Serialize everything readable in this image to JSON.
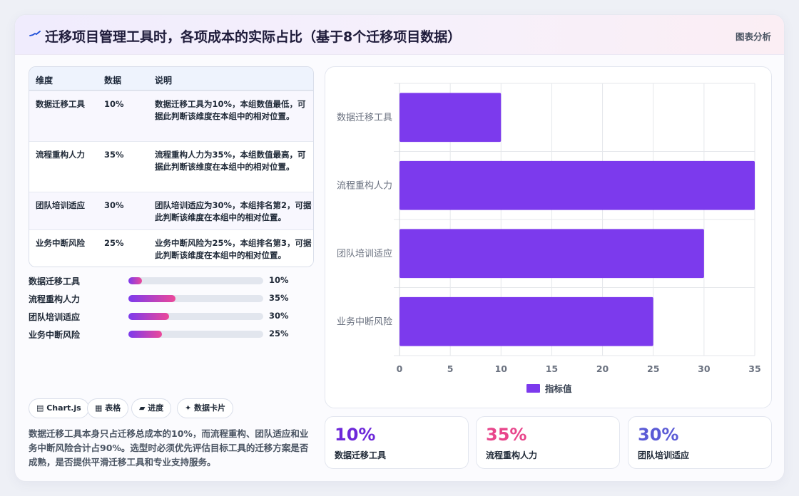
{
  "header": {
    "title": "迁移项目管理工具时，各项成本的实际占比（基于8个迁移项目数据）",
    "tag": "图表分析"
  },
  "table": {
    "headers": [
      "维度",
      "数据",
      "说明"
    ],
    "rows": [
      {
        "dim": "数据迁移工具",
        "val": "10%",
        "desc": "数据迁移工具为10%，本组数值最低，可据此判断该维度在本组中的相对位置。"
      },
      {
        "dim": "流程重构人力",
        "val": "35%",
        "desc": "流程重构人力为35%，本组数值最高，可据此判断该维度在本组中的相对位置。"
      },
      {
        "dim": "团队培训适应",
        "val": "30%",
        "desc": "团队培训适应为30%，本组排名第2，可据此判断该维度在本组中的相对位置。"
      },
      {
        "dim": "业务中断风险",
        "val": "25%",
        "desc": "业务中断风险为25%，本组排名第3，可据此判断该维度在本组中的相对位置。"
      }
    ]
  },
  "progress": [
    {
      "label": "数据迁移工具",
      "value": 10,
      "text": "10%"
    },
    {
      "label": "流程重构人力",
      "value": 35,
      "text": "35%"
    },
    {
      "label": "团队培训适应",
      "value": 30,
      "text": "30%"
    },
    {
      "label": "业务中断风险",
      "value": 25,
      "text": "25%"
    }
  ],
  "chips": [
    "▤ Chart.js",
    "▦ 表格",
    "▰ 进度",
    "✦ 数据卡片"
  ],
  "summary": "数据迁移工具本身只占迁移总成本的10%，而流程重构、团队适应和业务中断风险合计占90%。选型时必须优先评估目标工具的迁移方案是否成熟，是否提供平滑迁移工具和专业支持服务。",
  "stats": [
    {
      "value": "10%",
      "label": "数据迁移工具",
      "color": "#6d28d9"
    },
    {
      "value": "35%",
      "label": "流程重构人力",
      "color": "#e8458b"
    },
    {
      "value": "30%",
      "label": "团队培训适应",
      "color": "#5b5bd6"
    }
  ],
  "colors": {
    "bar": "#7c3aed",
    "accent": "#ec4899"
  },
  "chart_data": {
    "type": "bar",
    "orientation": "horizontal",
    "categories": [
      "数据迁移工具",
      "流程重构人力",
      "团队培训适应",
      "业务中断风险"
    ],
    "series": [
      {
        "name": "指标值",
        "values": [
          10,
          35,
          30,
          25
        ]
      }
    ],
    "xlim": [
      0,
      35
    ],
    "xticks": [
      0,
      5,
      10,
      15,
      20,
      25,
      30,
      35
    ],
    "grid": true,
    "legend": "bottom"
  }
}
